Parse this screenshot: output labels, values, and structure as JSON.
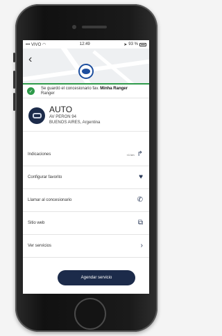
{
  "statusbar": {
    "carrier": "VIVO",
    "time": "12:49",
    "battery": "93 %"
  },
  "toast": {
    "prefix": "Se guardó el concesionario fav.",
    "dealer": "Minha Ranger",
    "suffix": "Ranger"
  },
  "dealer": {
    "name": "AUTO",
    "address_line1": "AV PERON 94",
    "address_line2": "BUENOS AIRES, Argentina"
  },
  "menu": [
    {
      "label": "Indicaciones",
      "extra": "≈1 km",
      "icon": "directions-icon"
    },
    {
      "label": "Configurar favorito",
      "extra": "",
      "icon": "heart-icon"
    },
    {
      "label": "Llamar al concesionario",
      "extra": "",
      "icon": "phone-icon"
    },
    {
      "label": "Sitio web",
      "extra": "",
      "icon": "external-link-icon"
    },
    {
      "label": "Ver servicios",
      "extra": "",
      "icon": "chevron-right-icon"
    }
  ],
  "cta": {
    "label": "Agendar servicio"
  },
  "colors": {
    "brand": "#1c2b4a",
    "success": "#2e9a4a",
    "pin": "#1d4e9e"
  }
}
